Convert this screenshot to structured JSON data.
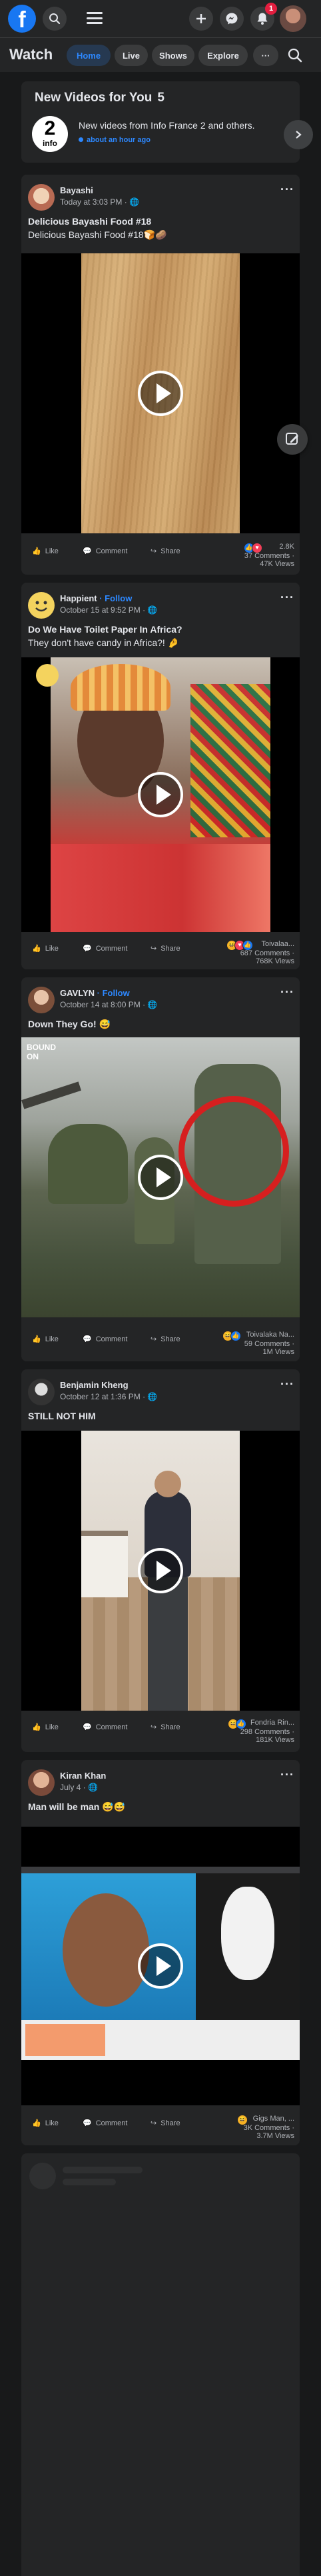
{
  "brand": {
    "logo_letter": "f",
    "accent": "#1877f2"
  },
  "topbar": {
    "notif_count": "1",
    "icons": [
      "search-icon",
      "menu-icon",
      "plus-icon",
      "messenger-icon",
      "bell-icon"
    ]
  },
  "nav": {
    "title": "Watch",
    "tabs": [
      {
        "label": "Home",
        "active": true
      },
      {
        "label": "Live"
      },
      {
        "label": "Shows"
      },
      {
        "label": "Explore"
      },
      {
        "label": "···"
      }
    ]
  },
  "new_videos": {
    "title": "New Videos for You",
    "count": "5",
    "logo_main": "2",
    "logo_sub": "info",
    "text": "New videos from Info France 2 and others.",
    "time": "about an hour ago"
  },
  "posts": [
    {
      "author": "Bayashi",
      "follow": "",
      "time": "Today at 3:03 PM · ",
      "caption": "Delicious Bayashi Food #18",
      "caption2": "Delicious Bayashi Food #18🍞🥔",
      "reactions": "2.8K",
      "comments": "37 Comments ·",
      "views": "47K Views",
      "actions": {
        "like": "Like",
        "comment": "Comment",
        "share": "Share"
      }
    },
    {
      "author": "Happient",
      "follow": " · Follow",
      "time": "October 15 at 9:52 PM · ",
      "caption": "Do We Have Toilet Paper In Africa?",
      "caption2": "They don't have candy in Africa?! 🤌",
      "reactions": "Toivalaa...",
      "comments": "687 Comments ·",
      "views": "768K Views",
      "actions": {
        "like": "Like",
        "comment": "Comment",
        "share": "Share"
      }
    },
    {
      "author": "GAVLYN",
      "follow": " · Follow",
      "time": "October 14 at 8:00 PM · ",
      "caption": "Down They Go! 😅",
      "caption2": "",
      "overlay_text": "BOUND ON",
      "reactions": "Toivalaka Na...",
      "comments": "59 Comments ·",
      "views": "1M Views",
      "actions": {
        "like": "Like",
        "comment": "Comment",
        "share": "Share"
      }
    },
    {
      "author": "Benjamin Kheng",
      "follow": "",
      "time": "October 12 at 1:36 PM · ",
      "caption": "STILL NOT HIM",
      "caption2": "",
      "reactions": "Fondria Rin...",
      "comments": "298 Comments ·",
      "views": "181K Views",
      "actions": {
        "like": "Like",
        "comment": "Comment",
        "share": "Share"
      }
    },
    {
      "author": "Kiran Khan",
      "follow": "",
      "time": "July 4 · ",
      "caption": "Man will be man 😅😅",
      "caption2": "",
      "reactions": "Gigs Man, ...",
      "comments": "3K Comments ·",
      "views": "3.7M Views",
      "actions": {
        "like": "Like",
        "comment": "Comment",
        "share": "Share"
      }
    }
  ]
}
